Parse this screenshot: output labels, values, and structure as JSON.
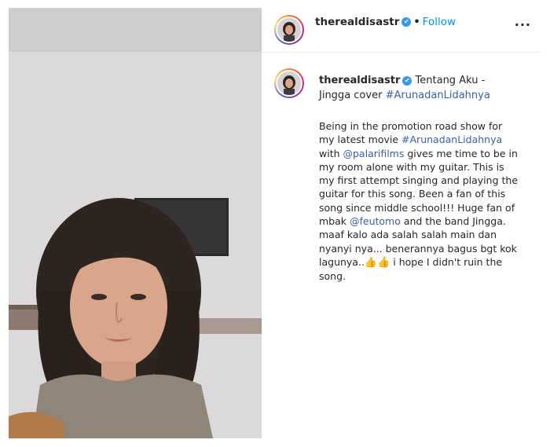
{
  "header": {
    "username": "therealdisastr",
    "verified_badge": "✔",
    "separator": "•",
    "follow_label": "Follow",
    "more_label": "···"
  },
  "caption": {
    "username": "therealdisastr",
    "verified_badge": "✔",
    "title_text": "Tentang Aku - Jingga cover ",
    "title_hashtag": "#ArunadanLidahnya",
    "body": {
      "p1": "Being in the promotion road show for my latest movie ",
      "hashtag": "#ArunadanLidahnya",
      "p2": " with ",
      "mention1": "@palarifilms",
      "p3": " gives me time to be in my room alone with my guitar. This is my first attempt singing and playing the guitar for this song. Been a fan of this song since middle school!!! Huge fan of mbak ",
      "mention2": "@feutomo",
      "p4": " and the band Jingga. maaf kalo ada salah salah main dan nyanyi nya... benerannya bagus bgt kok lagunya..",
      "emoji": "👍👍",
      "p5": " i hope I didn't ruin the song."
    }
  },
  "colors": {
    "link": "#3b5ea8",
    "follow": "#0095f6",
    "verified": "#3897f0"
  }
}
